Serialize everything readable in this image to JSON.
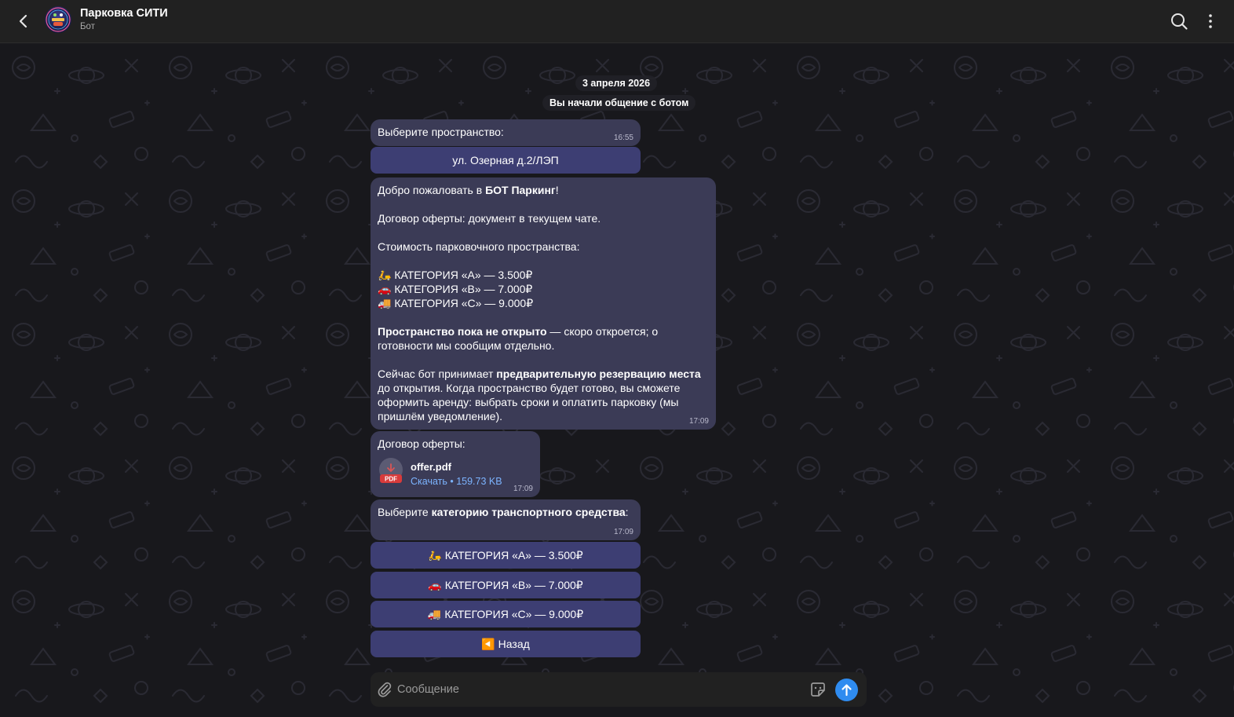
{
  "header": {
    "title": "Парковка СИТИ",
    "subtitle": "Бот"
  },
  "service": {
    "date": "3 апреля 2026",
    "started": "Вы начали общение с ботом"
  },
  "messages": {
    "choose_space": {
      "text": "Выберите пространство:",
      "time": "16:55"
    },
    "space_button": "ул. Озерная д.2/ЛЭП",
    "welcome": {
      "greeting_prefix": "Добро пожаловать в ",
      "greeting_bold": "БОТ Паркинг",
      "greeting_suffix": "!",
      "offer_line": "Договор оферты: документ в текущем чате.",
      "cost_heading": "Стоимость парковочного пространства:",
      "cat_a": "КАТЕГОРИЯ «А» — 3.500₽",
      "cat_b": "КАТЕГОРИЯ «В» — 7.000₽",
      "cat_c": "КАТЕГОРИЯ «С» — 9.000₽",
      "not_open_bold": "Пространство пока не открыто",
      "not_open_rest": " — скоро откроется; о готовности мы сообщим отдельно.",
      "reserve_prefix": "Сейчас бот принимает ",
      "reserve_bold": "предварительную резервацию места",
      "reserve_rest": " до открытия. Когда пространство будет готово, вы сможете оформить аренду: выбрать сроки и оплатить парковку (мы пришлём уведомление).",
      "time": "17:09"
    },
    "offer": {
      "title": "Договор оферты:",
      "file_name": "offer.pdf",
      "file_badge": "PDF",
      "file_link": "Скачать • 159.73 KB",
      "time": "17:09"
    },
    "choose_category": {
      "prefix": "Выберите ",
      "bold": "категорию транспортного средства",
      "suffix": ":",
      "time": "17:09"
    },
    "category_buttons": [
      {
        "emoji": "🛵",
        "label": "КАТЕГОРИЯ «А» — 3.500₽"
      },
      {
        "emoji": "🚗",
        "label": "КАТЕГОРИЯ «В» — 7.000₽"
      },
      {
        "emoji": "🚚",
        "label": "КАТЕГОРИЯ «С» — 9.000₽"
      },
      {
        "emoji": "◀️",
        "label": "Назад"
      }
    ]
  },
  "composer": {
    "placeholder": "Сообщение"
  },
  "colors": {
    "bubble": "#3b3b56",
    "keyboard_button": "#3d3e73",
    "accent": "#2f8cf0",
    "link": "#7cb4ff"
  },
  "icons": [
    "back-arrow-icon",
    "bot-avatar-icon",
    "search-icon",
    "more-vertical-icon",
    "pdf-file-icon",
    "paperclip-icon",
    "sticker-icon",
    "send-arrow-icon"
  ]
}
